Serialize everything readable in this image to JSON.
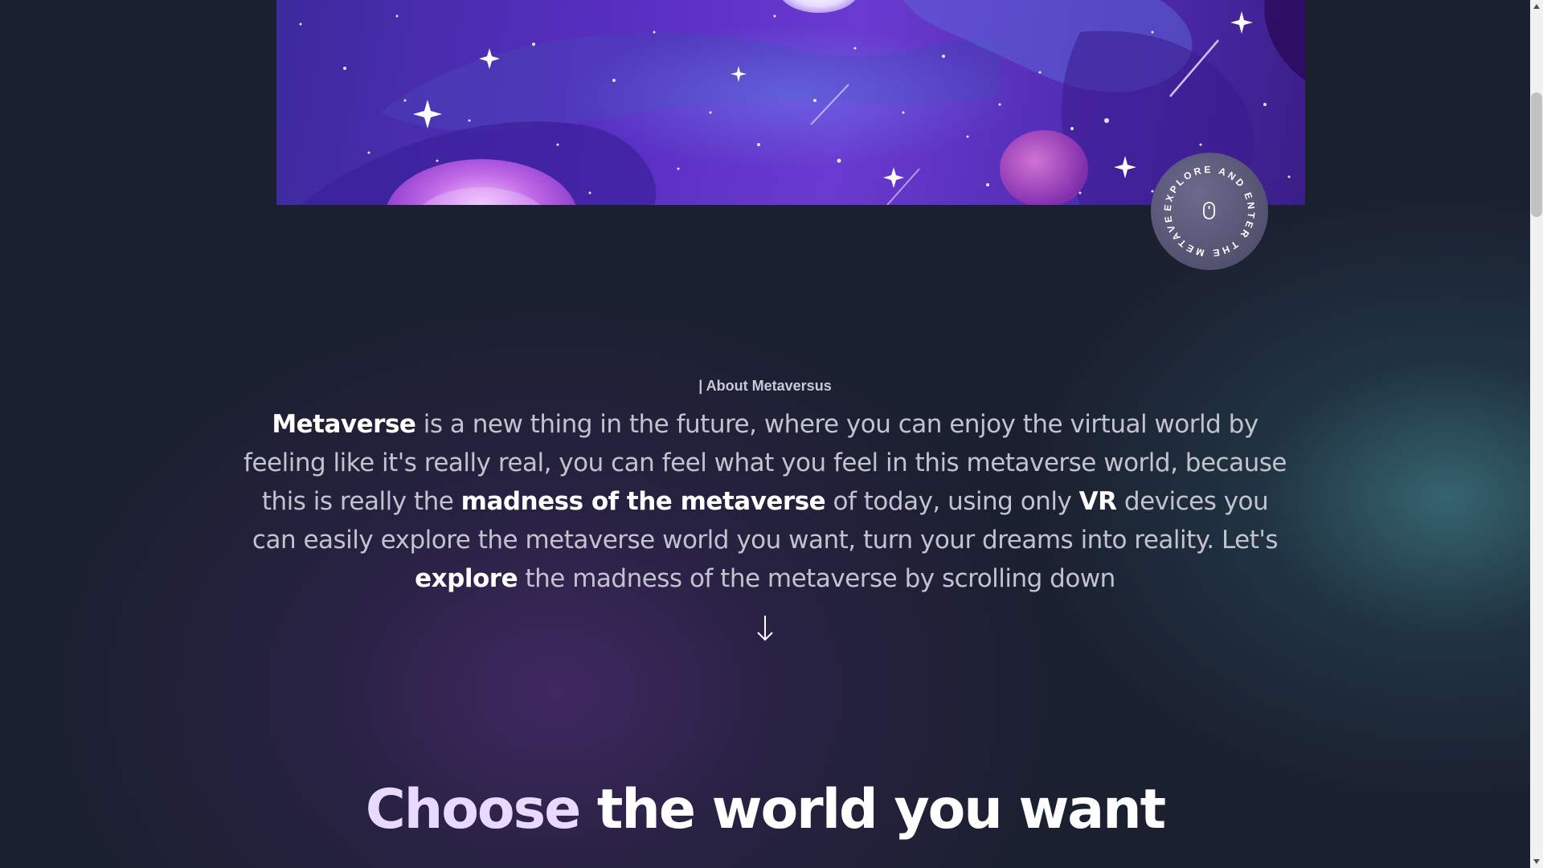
{
  "hero": {
    "image_name": "galaxy-space-illustration"
  },
  "badge": {
    "circular_text": "EXPLORE AND ENTER THE METAVERSE",
    "icon": "mouse-icon"
  },
  "about": {
    "label": "| About Metaversus",
    "text_parts": {
      "p1_bold": "Metaverse",
      "p2": " is a new thing in the future, where you can enjoy the virtual world by feeling like it's really real, you can feel what you feel in this metaverse world, because this is really the ",
      "p3_bold": "madness of the metaverse",
      "p4": " of today, using only ",
      "p5_bold": "VR",
      "p6": " devices you can easily explore the metaverse world you want, turn your dreams into reality. Let's ",
      "p7_bold": "explore",
      "p8": " the madness of the metaverse by scrolling down"
    },
    "arrow_icon": "arrow-down-icon"
  },
  "choose": {
    "title_accent": "Choose",
    "title_rest": " the world you want"
  },
  "colors": {
    "page_bg": "#1b2030",
    "accent_purple": "#a855f7",
    "title_accent": "#e9d9ff",
    "badge_bg": "#565574"
  }
}
